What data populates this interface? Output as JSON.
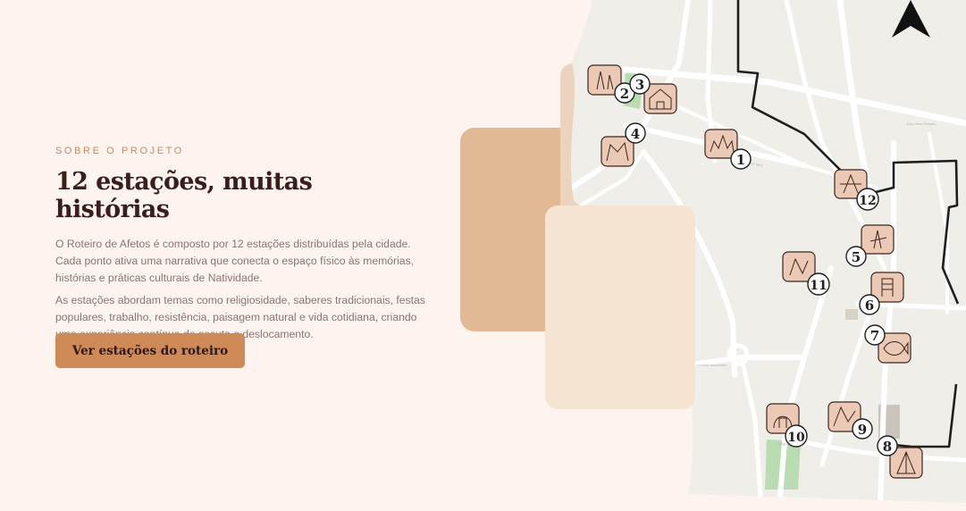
{
  "section": {
    "kicker": "SOBRE O PROJETO",
    "title": "12 estações, muitas histórias",
    "paragraphs": [
      "O Roteiro de Afetos é composto por 12 estações distribuídas pela cidade. Cada ponto ativa uma narrativa que conecta o espaço físico às memórias, histórias e práticas culturais de Natividade.",
      "As estações abordam temas como religiosidade, saberes tradicionais, festas populares, trabalho, resistência, paisagem natural e vida cotidiana, criando uma experiência contínua de escuta e deslocamento."
    ],
    "cta_label": "Ver estações do roteiro"
  },
  "map": {
    "north_icon": "north-arrow-icon",
    "stations": [
      "1",
      "2",
      "3",
      "4",
      "5",
      "6",
      "7",
      "8",
      "9",
      "10",
      "11",
      "12"
    ],
    "colors": {
      "land": "#efeee9",
      "road": "#ffffff",
      "border": "#1f1f1f",
      "marker_bg": "#ecc9b5",
      "park": "#b9dcb1"
    }
  },
  "colors": {
    "background": "#fdf4ef",
    "accent": "#cf8a57",
    "kicker": "#c98b5c",
    "title": "#3a1e1a",
    "text": "#8a7470"
  }
}
